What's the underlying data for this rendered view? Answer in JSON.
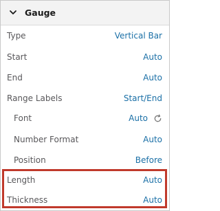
{
  "section": {
    "title": "Gauge",
    "collapse_icon": "chevron-down-icon"
  },
  "properties": {
    "type": {
      "label": "Type",
      "value": "Vertical Bar"
    },
    "start": {
      "label": "Start",
      "value": "Auto"
    },
    "end": {
      "label": "End",
      "value": "Auto"
    },
    "range_labels": {
      "label": "Range Labels",
      "value": "Start/End"
    },
    "font": {
      "label": "Font",
      "value": "Auto",
      "icon": "refresh-icon"
    },
    "number_format": {
      "label": "Number Format",
      "value": "Auto"
    },
    "position": {
      "label": "Position",
      "value": "Before"
    },
    "length": {
      "label": "Length",
      "value": "Auto"
    },
    "thickness": {
      "label": "Thickness",
      "value": "Auto"
    }
  },
  "colors": {
    "value_link": "#1a6fa6",
    "label_text": "#58575a",
    "highlight_border": "#c0392b",
    "header_bg": "#f3f3f3"
  }
}
